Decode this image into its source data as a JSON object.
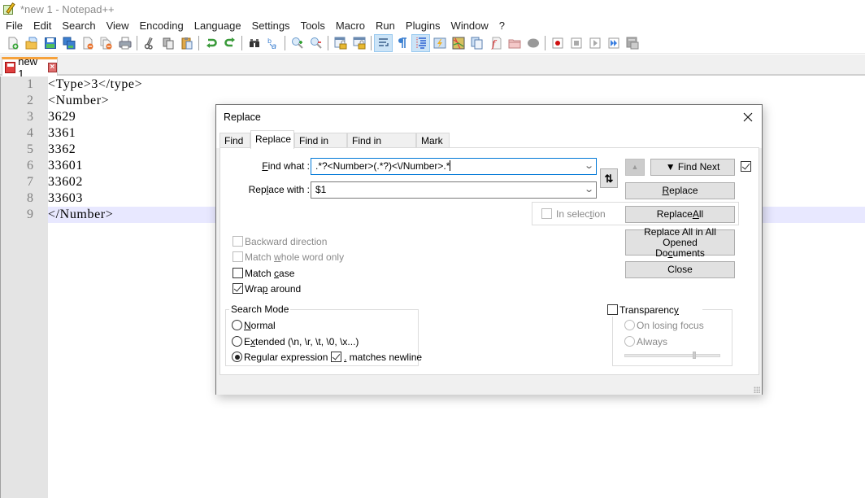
{
  "window": {
    "title": "*new 1 - Notepad++",
    "app_icon": "notepad-plus-plus-icon"
  },
  "menu": [
    "File",
    "Edit",
    "Search",
    "View",
    "Encoding",
    "Language",
    "Settings",
    "Tools",
    "Macro",
    "Run",
    "Plugins",
    "Window",
    "?"
  ],
  "toolbar": {
    "groups": [
      [
        "new-file-icon",
        "open-file-icon",
        "save-icon",
        "save-all-icon",
        "close-icon",
        "close-all-icon",
        "print-icon"
      ],
      [
        "cut-icon",
        "copy-icon",
        "paste-icon"
      ],
      [
        "undo-icon",
        "redo-icon"
      ],
      [
        "find-icon",
        "replace-icon"
      ],
      [
        "zoom-in-icon",
        "zoom-out-icon"
      ],
      [
        "sync-vertical-icon",
        "sync-horizontal-icon"
      ],
      [
        "word-wrap-icon",
        "show-all-chars-icon",
        "indent-guide-icon",
        "user-defined-language-icon",
        "document-map-icon",
        "document-list-icon",
        "function-list-icon",
        "folder-as-workspace-icon",
        "monitoring-icon"
      ],
      [
        "record-macro-icon",
        "stop-recording-icon",
        "play-macro-icon",
        "run-macro-multiple-icon",
        "save-macro-icon"
      ]
    ],
    "active": [
      "word-wrap-icon",
      "indent-guide-icon"
    ]
  },
  "tabs": [
    {
      "label": "new 1",
      "modified": true,
      "active": true
    }
  ],
  "editor": {
    "current_line": 9,
    "lines": [
      {
        "num": "1",
        "text": "<Type>3</type>"
      },
      {
        "num": "2",
        "text": "<Number>"
      },
      {
        "num": "3",
        "text": "3629"
      },
      {
        "num": "4",
        "text": "3361"
      },
      {
        "num": "5",
        "text": "3362"
      },
      {
        "num": "6",
        "text": "33601"
      },
      {
        "num": "7",
        "text": "33602"
      },
      {
        "num": "8",
        "text": "33603"
      },
      {
        "num": "9",
        "text": "</Number>"
      }
    ]
  },
  "dialog": {
    "title": "Replace",
    "tabs": [
      "Find",
      "Replace",
      "Find in Files",
      "Find in Projects",
      "Mark"
    ],
    "active_tab": "Replace",
    "find_what": {
      "label_pre": "",
      "label_u": "F",
      "label_post": "ind what :",
      "value": ".*?<Number>(.*?)<\\/Number>.*"
    },
    "replace_with": {
      "label_pre": "Rep",
      "label_u": "l",
      "label_post": "ace with :",
      "value": "$1"
    },
    "swap_icon": "swap-arrows-icon",
    "buttons": {
      "find_prev_icon": "triangle-up-icon",
      "find_next": "▼ Find Next",
      "replace_u": "R",
      "replace_post": "eplace",
      "replace_all_pre": "Replace ",
      "replace_all_u": "A",
      "replace_all_post": "ll",
      "replace_all_opened_line1": "Replace All in All Opened",
      "replace_all_opened_pre": "Do",
      "replace_all_opened_u": "c",
      "replace_all_opened_post": "uments",
      "close": "Close"
    },
    "in_selection": {
      "pre": "In selec",
      "u": "t",
      "post": "ion",
      "checked": false,
      "enabled": false
    },
    "options": [
      {
        "pre": "Backward direction",
        "u": "",
        "post": "",
        "checked": false,
        "enabled": false
      },
      {
        "pre": "Match ",
        "u": "w",
        "post": "hole word only",
        "checked": false,
        "enabled": false
      },
      {
        "pre": "Match ",
        "u": "c",
        "post": "ase",
        "checked": false,
        "enabled": true
      },
      {
        "pre": "Wra",
        "u": "p",
        "post": " around",
        "checked": true,
        "enabled": true
      }
    ],
    "search_mode": {
      "title": "Search Mode",
      "modes": [
        {
          "pre": "",
          "u": "N",
          "post": "ormal",
          "selected": false
        },
        {
          "pre": "E",
          "u": "x",
          "post": "tended (\\n, \\r, \\t, \\0, \\x...)",
          "selected": false
        },
        {
          "pre": "Re",
          "u": "g",
          "post": "ular expression",
          "selected": true
        }
      ],
      "matches_newline": {
        "u": ".",
        "post": " matches newline",
        "checked": true
      }
    },
    "transparency": {
      "pre": "Transparenc",
      "u": "y",
      "post": "",
      "checked": false,
      "on_losing_focus": "On losing focus",
      "always": "Always",
      "slider_value_percent": 73
    },
    "stay_on_top_checked": true
  }
}
